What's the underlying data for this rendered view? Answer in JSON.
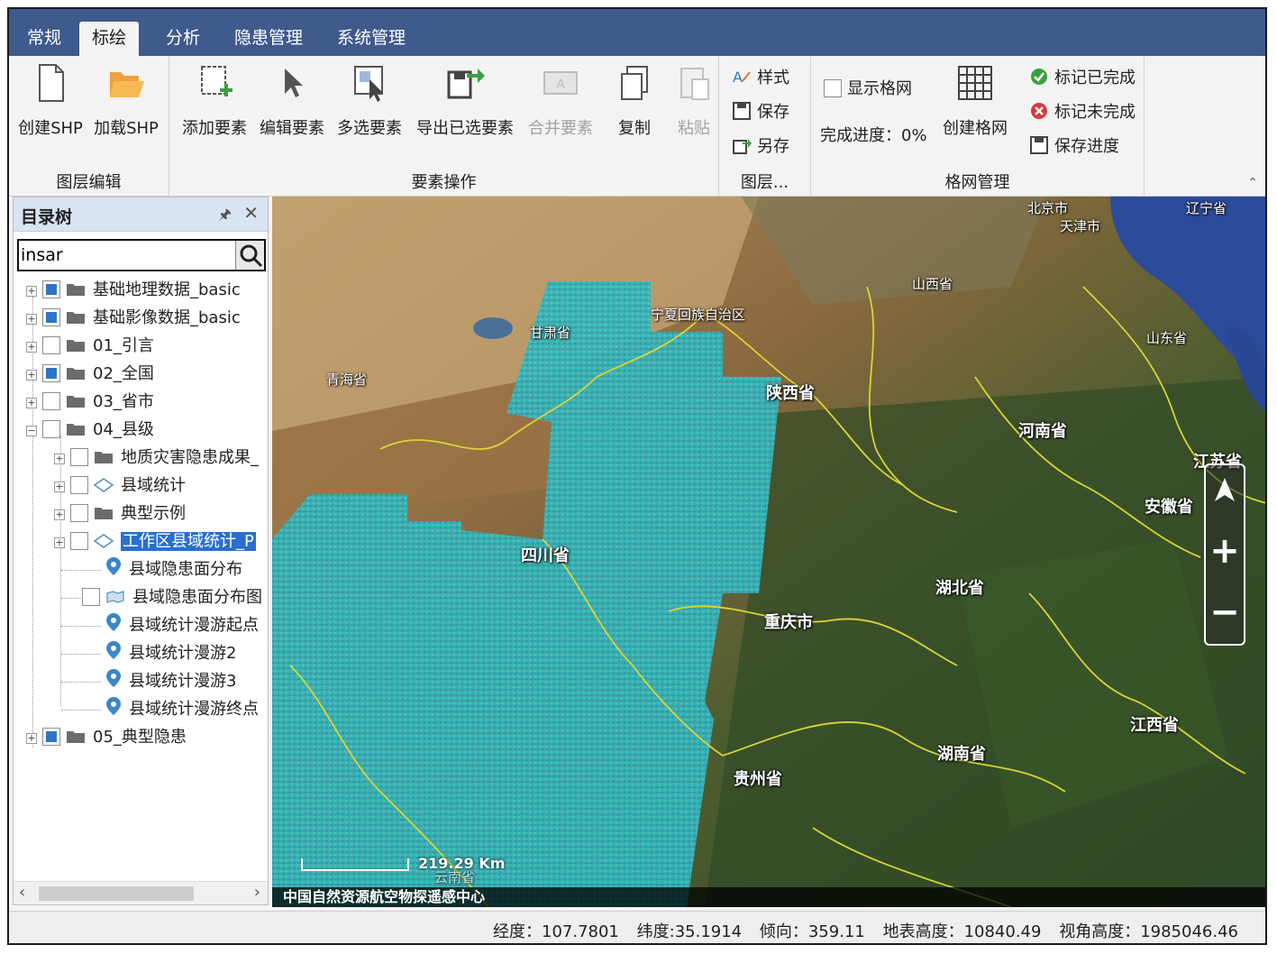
{
  "tabs": [
    "常规",
    "标绘",
    "分析",
    "隐患管理",
    "系统管理"
  ],
  "ribbon": {
    "layer_edit": {
      "create_shp": "创建SHP",
      "load_shp": "加载SHP",
      "group_label": "图层编辑"
    },
    "feature_ops": {
      "add": "添加要素",
      "edit": "编辑要素",
      "multi_select": "多选要素",
      "export_selected": "导出已选要素",
      "merge": "合并要素",
      "copy": "复制",
      "paste": "粘贴",
      "group_label": "要素操作"
    },
    "layer": {
      "style": "样式",
      "save": "保存",
      "save_as": "另存",
      "group_label": "图层..."
    },
    "grid": {
      "show_grid": "显示格网",
      "progress": "完成进度：0%",
      "create_grid": "创建格网",
      "mark_done": "标记已完成",
      "mark_undone": "标记未完成",
      "save_progress": "保存进度",
      "group_label": "格网管理"
    }
  },
  "catalog": {
    "title": "目录树",
    "search": {
      "value": "insar"
    },
    "items": [
      {
        "label": "基础地理数据_basic"
      },
      {
        "label": "基础影像数据_basic"
      },
      {
        "label": "01_引言"
      },
      {
        "label": "02_全国"
      },
      {
        "label": "03_省市"
      },
      {
        "label": "04_县级"
      },
      {
        "label": "地质灾害隐患成果_"
      },
      {
        "label": "县域统计"
      },
      {
        "label": "典型示例"
      },
      {
        "label": "工作区县域统计_P"
      },
      {
        "label": "县域隐患面分布"
      },
      {
        "label": "县域隐患面分布图"
      },
      {
        "label": "县域统计漫游起点"
      },
      {
        "label": "县域统计漫游2"
      },
      {
        "label": "县域统计漫游3"
      },
      {
        "label": "县域统计漫游终点"
      },
      {
        "label": "05_典型隐患"
      }
    ]
  },
  "map": {
    "labels": {
      "gansu": "甘肃省",
      "ningxia": "宁夏回族自治区",
      "qinghai": "青海省",
      "shaanxi": "陕西省",
      "shanxi": "山西省",
      "henan": "河南省",
      "shandong": "山东省",
      "jiangsu": "江苏省",
      "anhui": "安徽省",
      "hubei": "湖北省",
      "sichuan": "四川省",
      "chongqing": "重庆市",
      "guizhou": "贵州省",
      "hunan": "湖南省",
      "jiangxi": "江西省",
      "beijing": "北京市",
      "tianjin": "天津市",
      "liaoning": "辽宁省",
      "yunnan": "云南省"
    },
    "scale": "219.29 Km",
    "credit": "中国自然资源航空物探遥感中心"
  },
  "status": {
    "lon": "经度：107.7801",
    "lat": "纬度:35.1914",
    "heading": "倾向：359.11",
    "ground_alt": "地表高度：10840.49",
    "view_alt": "视角高度：1985046.46"
  }
}
